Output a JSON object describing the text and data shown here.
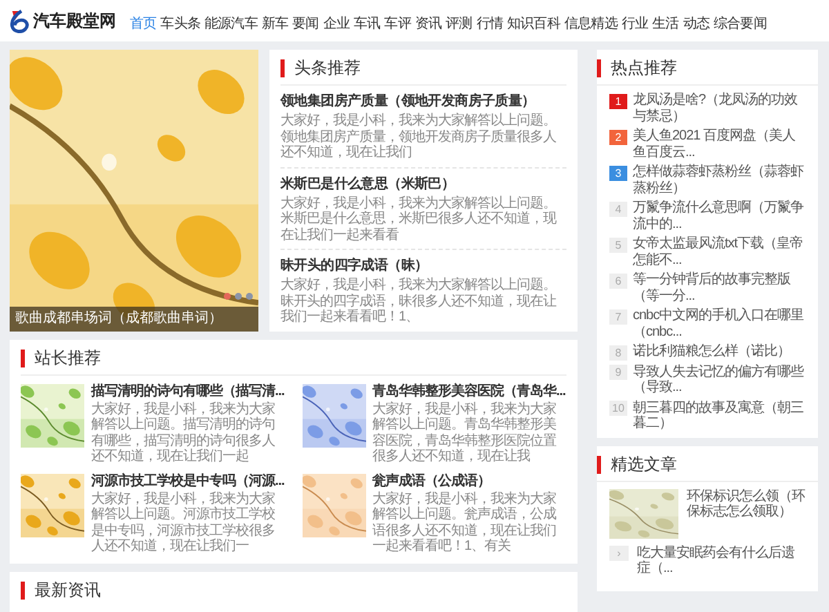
{
  "site": {
    "logo": "汽车殿堂网"
  },
  "nav": [
    {
      "label": "首页",
      "selected": true
    },
    {
      "label": "车头条",
      "selected": false
    },
    {
      "label": "能源汽车",
      "selected": false
    },
    {
      "label": "新车",
      "selected": false
    },
    {
      "label": "要闻",
      "selected": false
    },
    {
      "label": "企业",
      "selected": false
    },
    {
      "label": "车讯",
      "selected": false
    },
    {
      "label": "车评",
      "selected": false
    },
    {
      "label": "资讯",
      "selected": false
    },
    {
      "label": "评测",
      "selected": false
    },
    {
      "label": "行情",
      "selected": false
    },
    {
      "label": "知识百科",
      "selected": false
    },
    {
      "label": "信息精选",
      "selected": false
    },
    {
      "label": "行业",
      "selected": false
    },
    {
      "label": "生活",
      "selected": false
    },
    {
      "label": "动态",
      "selected": false
    },
    {
      "label": "综合要闻",
      "selected": false
    }
  ],
  "slider": {
    "caption": "歌曲成都串场词（成都歌曲串词）",
    "dots": [
      {
        "selected": true
      },
      {
        "selected": false
      },
      {
        "selected": false
      }
    ]
  },
  "headlines": {
    "title": "头条推荐",
    "items": [
      {
        "title": "领地集团房产质量（领地开发商房子质量）",
        "summary": "大家好，我是小科，我来为大家解答以上问题。领地集团房产质量，领地开发商房子质量很多人还不知道，现在让我们"
      },
      {
        "title": "米斯巴是什么意思（米斯巴）",
        "summary": "大家好，我是小科，我来为大家解答以上问题。米斯巴是什么意思，米斯巴很多人还不知道，现在让我们一起来看看"
      },
      {
        "title": "昧开头的四字成语（昧）",
        "summary": "大家好，我是小科，我来为大家解答以上问题。昧开头的四字成语，昧很多人还不知道，现在让我们一起来看看吧！1、"
      }
    ]
  },
  "station": {
    "title": "站长推荐",
    "items": [
      {
        "title": "描写清明的诗句有哪些（描写清...",
        "summary": "大家好，我是小科，我来为大家解答以上问题。描写清明的诗句有哪些，描写清明的诗句很多人还不知道，现在让我们一起"
      },
      {
        "title": "青岛华韩整形美容医院（青岛华...",
        "summary": "大家好，我是小科，我来为大家解答以上问题。青岛华韩整形美容医院，青岛华韩整形医院位置很多人还不知道，现在让我"
      },
      {
        "title": "河源市技工学校是中专吗（河源...",
        "summary": "大家好，我是小科，我来为大家解答以上问题。河源市技工学校是中专吗，河源市技工学校很多人还不知道，现在让我们一"
      },
      {
        "title": "瓮声成语（公成语）",
        "summary": "大家好，我是小科，我来为大家解答以上问题。瓮声成语，公成语很多人还不知道，现在让我们一起来看看吧！1、有关"
      }
    ]
  },
  "latest": {
    "title": "最新资讯"
  },
  "hot": {
    "title": "热点推荐",
    "items": [
      {
        "rank": "1",
        "text": "龙凤汤是啥?（龙凤汤的功效与禁忌）",
        "color": "#e01b1b",
        "kind": "top"
      },
      {
        "rank": "2",
        "text": "美人鱼2021 百度网盘（美人鱼百度云...",
        "color": "#f2643c",
        "kind": "top"
      },
      {
        "rank": "3",
        "text": "怎样做蒜蓉虾蒸粉丝（蒜蓉虾蒸粉丝）",
        "color": "#3b8ee0",
        "kind": "top"
      },
      {
        "rank": "4",
        "text": "万鬣争流什么意思啊（万鬣争流中的...",
        "color": "#eeeeee",
        "kind": "normal"
      },
      {
        "rank": "5",
        "text": "女帝太监最风流txt下载（皇帝怎能不...",
        "color": "#eeeeee",
        "kind": "normal"
      },
      {
        "rank": "6",
        "text": "等一分钟背后的故事完整版（等一分...",
        "color": "#eeeeee",
        "kind": "normal"
      },
      {
        "rank": "7",
        "text": "cnbc中文网的手机入口在哪里（cnbc...",
        "color": "#eeeeee",
        "kind": "normal"
      },
      {
        "rank": "8",
        "text": "诺比利猫粮怎么样（诺比）",
        "color": "#eeeeee",
        "kind": "normal"
      },
      {
        "rank": "9",
        "text": "导致人失去记忆的偏方有哪些（导致...",
        "color": "#eeeeee",
        "kind": "normal"
      },
      {
        "rank": "10",
        "text": "朝三暮四的故事及寓意（朝三暮二）",
        "color": "#eeeeee",
        "kind": "normal"
      }
    ]
  },
  "featured": {
    "title": "精选文章",
    "items": [
      {
        "kind": "thumb",
        "text": "环保标识怎么领（环保标志怎么领取）"
      },
      {
        "kind": "plain",
        "rank": "›",
        "text": "吃大量安眠药会有什么后遗症（..."
      }
    ]
  }
}
